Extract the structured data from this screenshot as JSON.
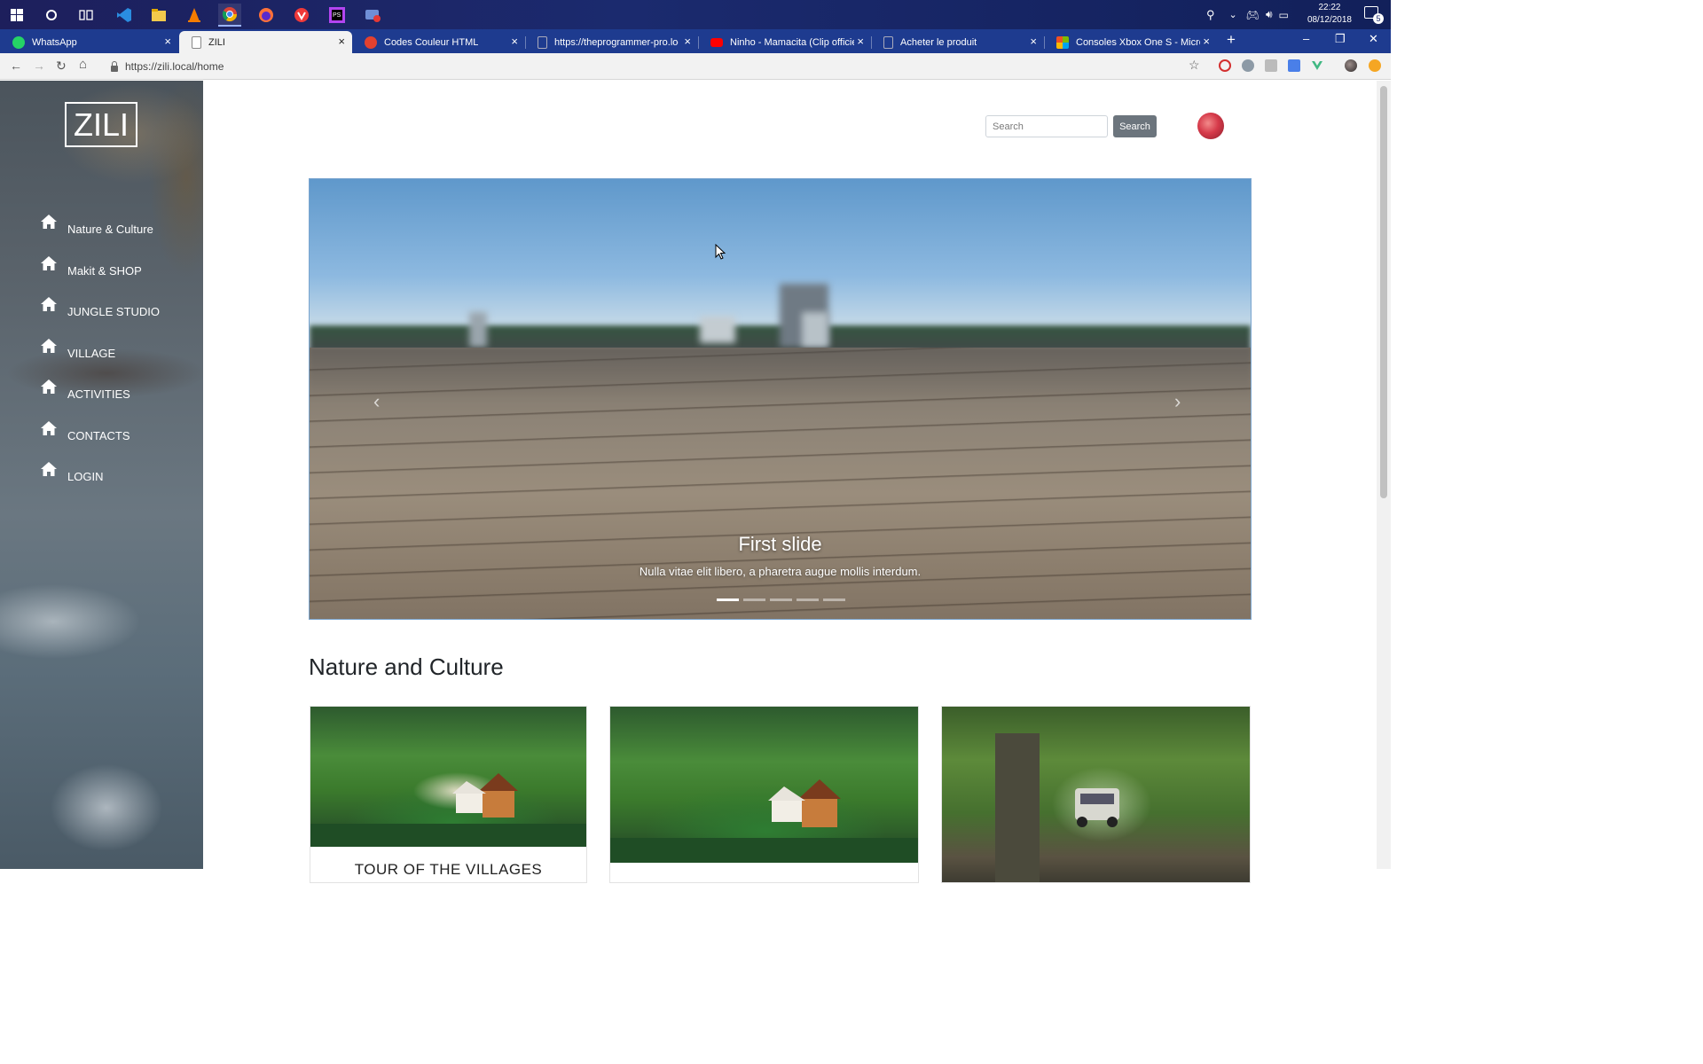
{
  "taskbar": {
    "clock_time": "22:22",
    "clock_date": "08/12/2018",
    "notification_count": "5"
  },
  "browser": {
    "tabs": [
      {
        "label": "WhatsApp",
        "favicon_color": "#25d366"
      },
      {
        "label": "ZILI",
        "favicon_color": "#9e9e9e"
      },
      {
        "label": "Codes Couleur HTML",
        "favicon_color": "#e2412f"
      },
      {
        "label": "https://theprogrammer-pro.local",
        "favicon_color": "#9e9e9e"
      },
      {
        "label": "Ninho - Mamacita (Clip officiel) -",
        "favicon_color": "#ff0000"
      },
      {
        "label": "Acheter le produit",
        "favicon_color": "#9e9e9e"
      },
      {
        "label": "Consoles Xbox One S - Microsoft",
        "favicon_color": "#f25022"
      }
    ],
    "url": "https://zili.local/home"
  },
  "sidebar": {
    "logo": "ZILI",
    "items": [
      {
        "label": "Nature & Culture",
        "icon": "home-icon"
      },
      {
        "label": "Makit & SHOP",
        "icon": "home-icon"
      },
      {
        "label": "JUNGLE STUDIO",
        "icon": "home-icon"
      },
      {
        "label": "VILLAGE",
        "icon": "home-icon"
      },
      {
        "label": "ACTIVITIES",
        "icon": "home-icon"
      },
      {
        "label": "CONTACTS",
        "icon": "home-icon"
      },
      {
        "label": "LOGIN",
        "icon": "home-icon"
      }
    ]
  },
  "header": {
    "search_placeholder": "Search",
    "search_button": "Search"
  },
  "carousel": {
    "title": "First slide",
    "text": "Nulla vitae elit libero, a pharetra augue mollis interdum.",
    "slide_count": 5,
    "active_slide": 1,
    "prev_icon": "chevron-left-icon",
    "next_icon": "chevron-right-icon"
  },
  "section": {
    "title": "Nature and Culture",
    "cards": [
      {
        "title": "TOUR OF THE VILLAGES",
        "image": "forest-lake-house"
      },
      {
        "title": "",
        "image": "forest-lake-house"
      },
      {
        "title": "",
        "image": "jungle-jeep"
      }
    ]
  }
}
